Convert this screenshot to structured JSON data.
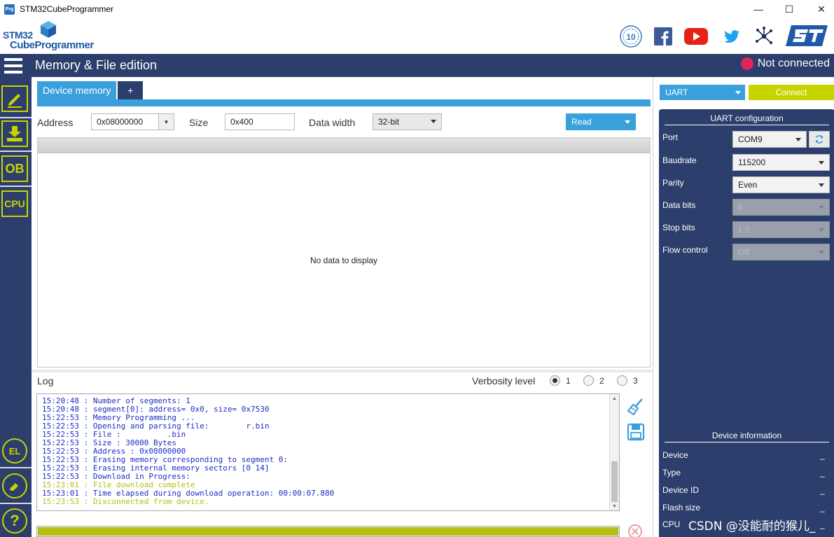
{
  "window": {
    "title": "STM32CubeProgrammer",
    "app_icon_text": "Prg",
    "minimize": "—",
    "maximize": "☐",
    "close": "✕"
  },
  "brand": {
    "logo_line1": "STM32",
    "logo_line2": "CubeProgrammer",
    "badge": "10"
  },
  "header": {
    "title": "Memory & File edition",
    "status": "Not connected",
    "status_color": "#e0245e"
  },
  "sidebar": {
    "items": [
      {
        "name": "memory-file-edit",
        "icon": "pencil-icon"
      },
      {
        "name": "erasing-programming",
        "icon": "download-icon"
      },
      {
        "name": "option-bytes",
        "icon": "ob-icon",
        "text": "OB"
      },
      {
        "name": "cpu",
        "icon": "cpu-icon",
        "text": "CPU"
      }
    ],
    "bottom": [
      {
        "name": "el",
        "icon": "el-chip-icon",
        "text": "EL"
      },
      {
        "name": "eraser",
        "icon": "eraser-icon"
      },
      {
        "name": "help",
        "icon": "help-icon",
        "text": "?"
      }
    ]
  },
  "main": {
    "tabs": [
      {
        "label": "Device memory"
      },
      {
        "label": "+"
      }
    ],
    "toolbar": {
      "address_label": "Address",
      "address_value": "0x08000000",
      "size_label": "Size",
      "size_value": "0x400",
      "data_width_label": "Data width",
      "data_width_value": "32-bit",
      "read_label": "Read"
    },
    "grid": {
      "empty_text": "No data to display"
    },
    "log": {
      "label": "Log",
      "verbosity_label": "Verbosity level",
      "verbosity_options": [
        "1",
        "2",
        "3"
      ],
      "verbosity_selected": "1",
      "lines": [
        {
          "text": "15:20:48 : Number of segments: 1",
          "kind": "normal"
        },
        {
          "text": "15:20:48 : segment[0]: address= 0x0, size= 0x7530",
          "kind": "normal"
        },
        {
          "text": "15:22:53 : Memory Programming ...",
          "kind": "normal"
        },
        {
          "text": "15:22:53 : Opening and parsing file:        r.bin",
          "kind": "normal"
        },
        {
          "text": "15:22:53 : File :          .bin",
          "kind": "normal"
        },
        {
          "text": "15:22:53 : Size : 30000 Bytes",
          "kind": "normal"
        },
        {
          "text": "15:22:53 : Address : 0x08000000",
          "kind": "normal"
        },
        {
          "text": "15:22:53 : Erasing memory corresponding to segment 0:",
          "kind": "normal"
        },
        {
          "text": "15:22:53 : Erasing internal memory sectors [0 14]",
          "kind": "normal"
        },
        {
          "text": "15:22:53 : Download in Progress:",
          "kind": "normal"
        },
        {
          "text": "15:23:01 : File download complete",
          "kind": "success"
        },
        {
          "text": "15:23:01 : Time elapsed during download operation: 00:00:07.880",
          "kind": "normal"
        },
        {
          "text": "15:23:53 : Disconnected from device.",
          "kind": "success"
        }
      ]
    },
    "progress": {
      "value": 1.0
    }
  },
  "right": {
    "interface": "UART",
    "connect_label": "Connect",
    "uart_config_title": "UART configuration",
    "config": [
      {
        "label": "Port",
        "value": "COM9",
        "disabled": false
      },
      {
        "label": "Baudrate",
        "value": "115200",
        "disabled": false
      },
      {
        "label": "Parity",
        "value": "Even",
        "disabled": false
      },
      {
        "label": "Data bits",
        "value": "8",
        "disabled": true
      },
      {
        "label": "Stop bits",
        "value": "1.0",
        "disabled": true
      },
      {
        "label": "Flow control",
        "value": "Off",
        "disabled": true
      }
    ],
    "device_info_title": "Device information",
    "device_info": [
      {
        "label": "Device",
        "value": "_"
      },
      {
        "label": "Type",
        "value": "_"
      },
      {
        "label": "Device ID",
        "value": "_"
      },
      {
        "label": "Flash size",
        "value": "_"
      },
      {
        "label": "CPU",
        "value": "_"
      }
    ]
  },
  "watermark": "CSDN @没能耐的猴儿_",
  "colors": {
    "navy": "#2c3e6b",
    "blue": "#3aa0dc",
    "lime": "#c8d400",
    "log_blue": "#1d2ec4",
    "log_green": "#b4bf14"
  }
}
